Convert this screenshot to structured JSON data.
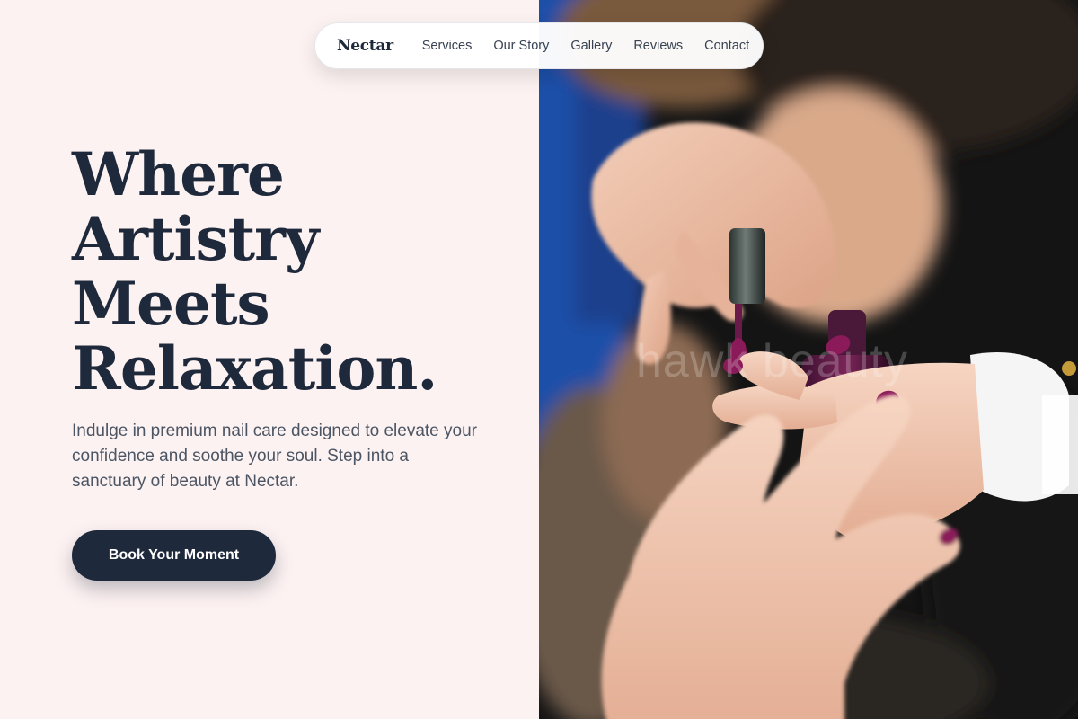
{
  "nav": {
    "logo": "Nectar",
    "links": [
      "Services",
      "Our Story",
      "Gallery",
      "Reviews",
      "Contact"
    ]
  },
  "hero": {
    "headline_lines": [
      "Where",
      "Artistry",
      "Meets",
      "Relaxation."
    ],
    "subtext": "Indulge in premium nail care designed to elevate your confidence and soothe your soul. Step into a sanctuary of beauty at Nectar.",
    "cta_label": "Book Your Moment"
  },
  "image": {
    "description_icon": "manicure-photo",
    "watermark": "hawk beauty"
  },
  "colors": {
    "background": "#fdf2f2",
    "primary": "#1e293b",
    "text_muted": "#4b5563",
    "nail_polish": "#8b1a5a"
  }
}
